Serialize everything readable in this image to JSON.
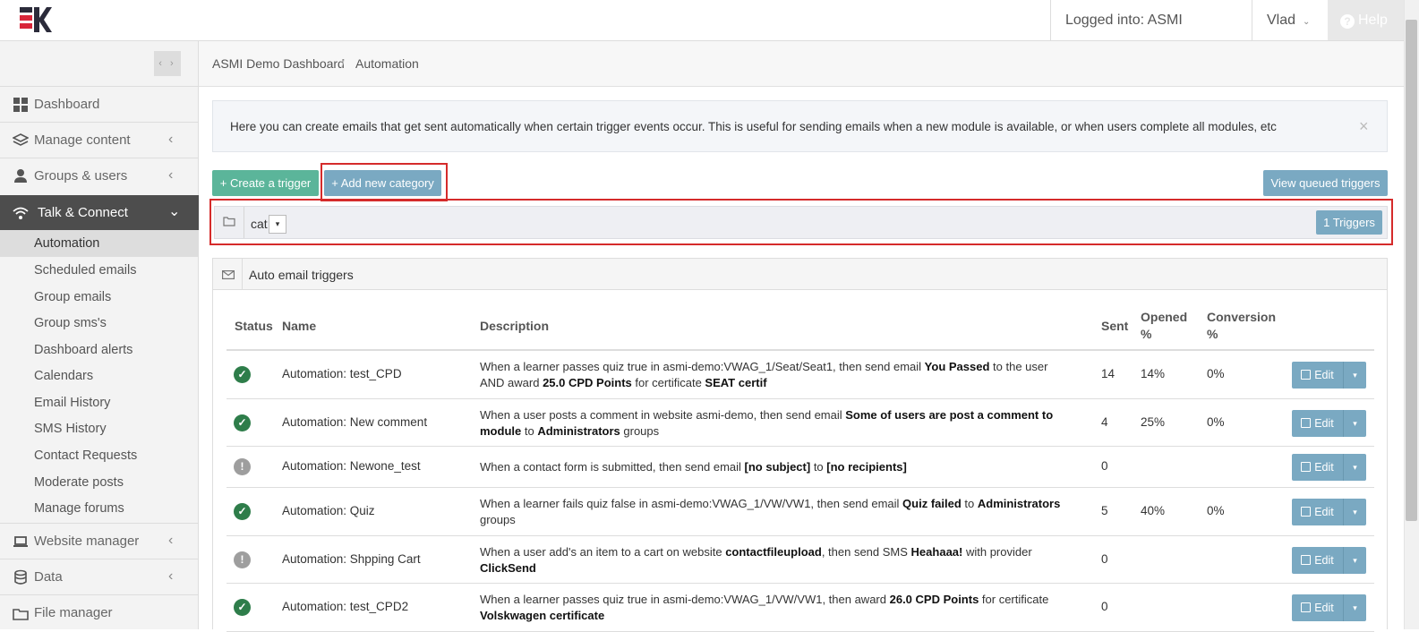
{
  "topbar": {
    "logged_into": "Logged into: ASMI Demo",
    "user": "Vlad",
    "help": "Help",
    "help_icon": "?"
  },
  "sidebar": {
    "collapse_arrows": "‹ ›",
    "items": [
      {
        "label": "Dashboard",
        "icon": "dashboard-icon"
      },
      {
        "label": "Manage content",
        "icon": "layers-icon"
      },
      {
        "label": "Groups & users",
        "icon": "user-icon"
      },
      {
        "label": "Talk & Connect",
        "icon": "wifi-icon"
      },
      {
        "label": "Website manager",
        "icon": "laptop-icon"
      },
      {
        "label": "Data",
        "icon": "database-icon"
      },
      {
        "label": "File manager",
        "icon": "folder-icon"
      }
    ],
    "submenu": [
      "Automation",
      "Scheduled emails",
      "Group emails",
      "Group sms's",
      "Dashboard alerts",
      "Calendars",
      "Email History",
      "SMS History",
      "Contact Requests",
      "Moderate posts",
      "Manage forums"
    ]
  },
  "breadcrumb": {
    "root": "ASMI Demo Dashboard",
    "separator": "/",
    "current": "Automation"
  },
  "info": {
    "text": "Here you can create emails that get sent automatically when certain trigger events occur. This is useful for sending emails when a new module is available, or when users complete all modules, etc",
    "close": "×"
  },
  "actions": {
    "create_trigger": "+ Create a trigger",
    "add_category": "+ Add new category",
    "view_queued": "View queued triggers"
  },
  "category": {
    "name": "cat",
    "dropdown": "▾",
    "triggers_label": "1 Triggers"
  },
  "panel": {
    "title": "Auto email triggers"
  },
  "table": {
    "headers": {
      "status": "Status",
      "name": "Name",
      "description": "Description",
      "sent": "Sent",
      "opened_a": "Opened",
      "opened_b": "%",
      "conversion_a": "Conversion",
      "conversion_b": "%"
    },
    "edit_label": "Edit",
    "edit_caret": "▾",
    "rows": [
      {
        "status": "ok",
        "name": "Automation: test_CPD",
        "desc_parts": [
          "When a learner passes quiz true in asmi-demo:VWAG_1/Seat/Seat1, then send email ",
          "You Passed",
          " to the user AND award ",
          "25.0 CPD Points",
          " for certificate ",
          "SEAT certif"
        ],
        "sent": "14",
        "opened": "14%",
        "conversion": "0%"
      },
      {
        "status": "ok",
        "name": "Automation: New comment",
        "desc_parts": [
          "When a user posts a comment in website asmi-demo, then send email ",
          "Some of users are post a comment to module",
          " to ",
          "Administrators",
          " groups"
        ],
        "sent": "4",
        "opened": "25%",
        "conversion": "0%"
      },
      {
        "status": "warn",
        "name": "Automation: Newone_test",
        "desc_parts": [
          "When a contact form is submitted, then send email ",
          "[no subject]",
          " to ",
          "[no recipients]"
        ],
        "sent": "0",
        "opened": "",
        "conversion": ""
      },
      {
        "status": "ok",
        "name": "Automation: Quiz",
        "desc_parts": [
          "When a learner fails quiz false in asmi-demo:VWAG_1/VW/VW1, then send email ",
          "Quiz failed",
          " to ",
          "Administrators",
          " groups"
        ],
        "sent": "5",
        "opened": "40%",
        "conversion": "0%"
      },
      {
        "status": "warn",
        "name": "Automation: Shpping Cart",
        "desc_parts": [
          "When a user add's an item to a cart on website ",
          "contactfileupload",
          ", then send SMS ",
          "Heahaaa!",
          " with provider ",
          "ClickSend"
        ],
        "sent": "0",
        "opened": "",
        "conversion": ""
      },
      {
        "status": "ok",
        "name": "Automation: test_CPD2",
        "desc_parts": [
          "When a learner passes quiz true in asmi-demo:VWAG_1/VW/VW1, then award ",
          "26.0 CPD Points",
          " for certificate ",
          "Volskwagen certificate"
        ],
        "sent": "0",
        "opened": "",
        "conversion": ""
      }
    ]
  }
}
